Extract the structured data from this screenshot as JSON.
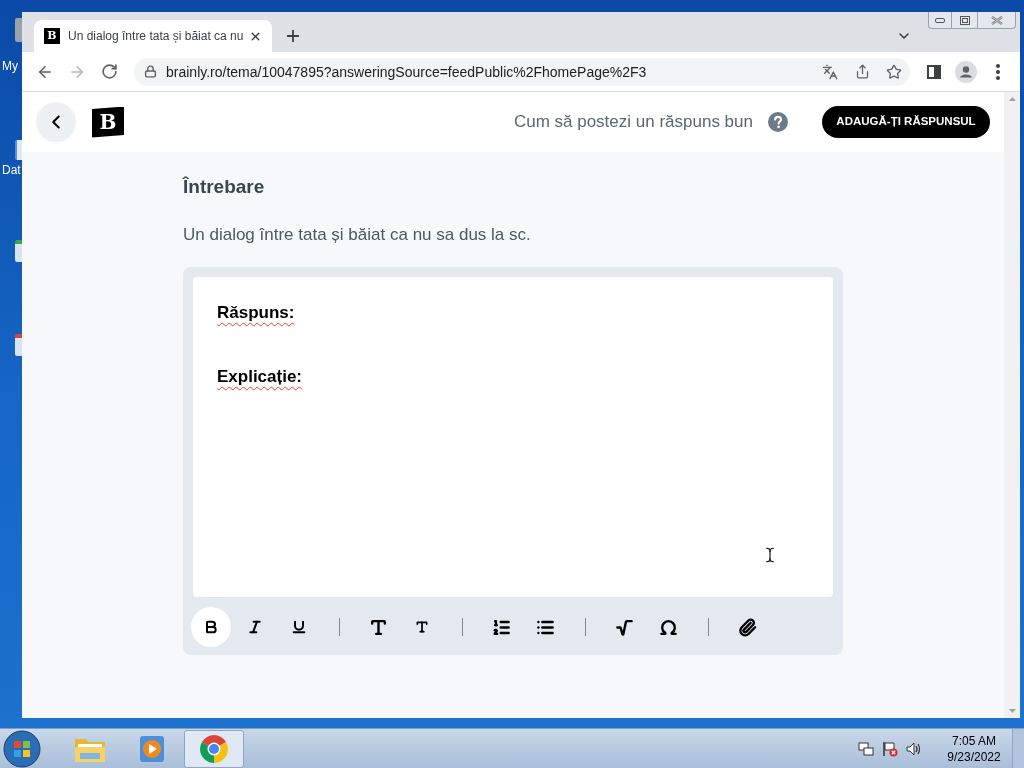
{
  "desktop": {
    "icons": [
      {
        "label": "My"
      },
      {
        "label": "Dat"
      }
    ]
  },
  "browser": {
    "tabs": [
      {
        "title": "Un dialog între tata și băiat ca nu",
        "favicon": "B",
        "selected": true
      }
    ],
    "navigation": {
      "back_disabled": false,
      "forward_disabled": true
    },
    "address_bar": {
      "url": "brainly.ro/tema/10047895?answeringSource=feedPublic%2FhomePage%2F3"
    }
  },
  "page": {
    "header": {
      "logo": "B",
      "help_link": "Cum să postezi un răspuns bun",
      "primary_button": "ADAUGĂ-ȚI RĂSPUNSUL"
    },
    "question": {
      "heading": "Întrebare",
      "text": "Un dialog între tata și băiat ca nu sa dus la sc."
    },
    "editor": {
      "paragraphs": [
        {
          "text": "Răspuns:",
          "misspelled": true
        },
        {
          "text": "Explicație:",
          "misspelled": true
        }
      ],
      "toolbar_groups": [
        [
          {
            "kind": "bold",
            "selected": true
          },
          {
            "kind": "italic",
            "selected": false
          },
          {
            "kind": "underline",
            "selected": false
          }
        ],
        [
          {
            "kind": "heading",
            "selected": false
          },
          {
            "kind": "subheading",
            "selected": false
          }
        ],
        [
          {
            "kind": "ordered_list",
            "selected": false
          },
          {
            "kind": "bullet_list",
            "selected": false
          }
        ],
        [
          {
            "kind": "equation",
            "selected": false
          },
          {
            "kind": "special_character",
            "selected": false
          }
        ],
        [
          {
            "kind": "attachment",
            "selected": false
          }
        ]
      ]
    }
  },
  "taskbar": {
    "apps": [
      {
        "kind": "explorer",
        "selected": false
      },
      {
        "kind": "media_player",
        "selected": false
      },
      {
        "kind": "chrome",
        "selected": true
      }
    ],
    "clock": {
      "time": "7:05 AM",
      "date": "9/23/2022"
    }
  }
}
